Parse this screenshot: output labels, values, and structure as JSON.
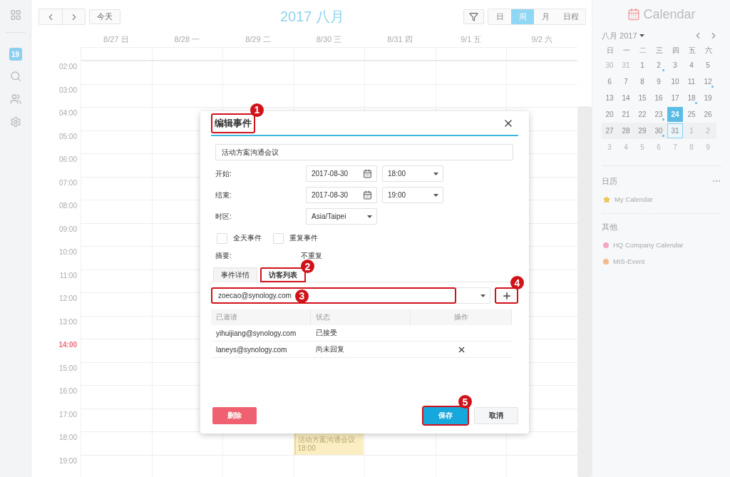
{
  "rail": {
    "items": [
      {
        "kind": "apps",
        "selected": false
      },
      {
        "kind": "calendar",
        "badge": "19",
        "selected": true
      },
      {
        "kind": "search",
        "selected": false
      },
      {
        "kind": "people",
        "selected": false
      },
      {
        "kind": "settings",
        "selected": false
      }
    ]
  },
  "toolbar": {
    "today": "今天",
    "title": "2017 八月",
    "views": [
      {
        "label": "日",
        "selected": false
      },
      {
        "label": "周",
        "selected": true
      },
      {
        "label": "月",
        "selected": false
      },
      {
        "label": "日程",
        "selected": false
      }
    ]
  },
  "week": {
    "days": [
      {
        "label": "8/27 日"
      },
      {
        "label": "8/28 一"
      },
      {
        "label": "8/29 二"
      },
      {
        "label": "8/30 三",
        "events": [
          {
            "title": "活动方案沟通会议",
            "time": "18:00",
            "color": "#fbeec3"
          }
        ]
      },
      {
        "label": "8/31 四"
      },
      {
        "label": "9/1 五"
      },
      {
        "label": "9/2 六"
      }
    ],
    "hours": [
      {
        "label": "02:00",
        "now": false
      },
      {
        "label": "03:00",
        "now": false
      },
      {
        "label": "04:00",
        "now": false
      },
      {
        "label": "05:00",
        "now": false
      },
      {
        "label": "06:00",
        "now": false
      },
      {
        "label": "07:00",
        "now": false
      },
      {
        "label": "08:00",
        "now": false
      },
      {
        "label": "09:00",
        "now": false
      },
      {
        "label": "10:00",
        "now": false
      },
      {
        "label": "11:00",
        "now": false
      },
      {
        "label": "12:00",
        "now": false
      },
      {
        "label": "13:00",
        "now": false
      },
      {
        "label": "14:00",
        "now": true
      },
      {
        "label": "15:00",
        "now": false
      },
      {
        "label": "16:00",
        "now": false
      },
      {
        "label": "17:00",
        "now": false
      },
      {
        "label": "18:00",
        "now": false
      },
      {
        "label": "19:00",
        "now": false
      }
    ]
  },
  "sidebar": {
    "app_title": "Calendar",
    "mini_calendar": {
      "month": "八月 2017",
      "weekdays": [
        "日",
        "一",
        "二",
        "三",
        "四",
        "五",
        "六"
      ],
      "weeks": [
        {
          "current": false,
          "days": [
            {
              "d": "30",
              "muted": true,
              "dot": false,
              "selected": false,
              "today": false
            },
            {
              "d": "31",
              "muted": true,
              "dot": false,
              "selected": false,
              "today": false
            },
            {
              "d": "1",
              "muted": false,
              "dot": false,
              "selected": false,
              "today": false
            },
            {
              "d": "2",
              "muted": false,
              "dot": true,
              "selected": false,
              "today": false
            },
            {
              "d": "3",
              "muted": false,
              "dot": false,
              "selected": false,
              "today": false
            },
            {
              "d": "4",
              "muted": false,
              "dot": false,
              "selected": false,
              "today": false
            },
            {
              "d": "5",
              "muted": false,
              "dot": false,
              "selected": false,
              "today": false
            }
          ]
        },
        {
          "current": false,
          "days": [
            {
              "d": "6",
              "muted": false,
              "dot": false,
              "selected": false,
              "today": false
            },
            {
              "d": "7",
              "muted": false,
              "dot": false,
              "selected": false,
              "today": false
            },
            {
              "d": "8",
              "muted": false,
              "dot": false,
              "selected": false,
              "today": false
            },
            {
              "d": "9",
              "muted": false,
              "dot": false,
              "selected": false,
              "today": false
            },
            {
              "d": "10",
              "muted": false,
              "dot": false,
              "selected": false,
              "today": false
            },
            {
              "d": "11",
              "muted": false,
              "dot": false,
              "selected": false,
              "today": false
            },
            {
              "d": "12",
              "muted": false,
              "dot": true,
              "selected": false,
              "today": false
            }
          ]
        },
        {
          "current": false,
          "days": [
            {
              "d": "13",
              "muted": false,
              "dot": false,
              "selected": false,
              "today": false
            },
            {
              "d": "14",
              "muted": false,
              "dot": false,
              "selected": false,
              "today": false
            },
            {
              "d": "15",
              "muted": false,
              "dot": false,
              "selected": false,
              "today": false
            },
            {
              "d": "16",
              "muted": false,
              "dot": false,
              "selected": false,
              "today": false
            },
            {
              "d": "17",
              "muted": false,
              "dot": false,
              "selected": false,
              "today": false
            },
            {
              "d": "18",
              "muted": false,
              "dot": true,
              "selected": false,
              "today": false
            },
            {
              "d": "19",
              "muted": false,
              "dot": false,
              "selected": false,
              "today": false
            }
          ]
        },
        {
          "current": false,
          "days": [
            {
              "d": "20",
              "muted": false,
              "dot": false,
              "selected": false,
              "today": false
            },
            {
              "d": "21",
              "muted": false,
              "dot": false,
              "selected": false,
              "today": false
            },
            {
              "d": "22",
              "muted": false,
              "dot": false,
              "selected": false,
              "today": false
            },
            {
              "d": "23",
              "muted": false,
              "dot": true,
              "selected": false,
              "today": false
            },
            {
              "d": "24",
              "muted": false,
              "dot": false,
              "selected": true,
              "today": false
            },
            {
              "d": "25",
              "muted": false,
              "dot": false,
              "selected": false,
              "today": false
            },
            {
              "d": "26",
              "muted": false,
              "dot": false,
              "selected": false,
              "today": false
            }
          ]
        },
        {
          "current": true,
          "days": [
            {
              "d": "27",
              "muted": false,
              "dot": false,
              "selected": false,
              "today": false
            },
            {
              "d": "28",
              "muted": false,
              "dot": false,
              "selected": false,
              "today": false
            },
            {
              "d": "29",
              "muted": false,
              "dot": false,
              "selected": false,
              "today": false
            },
            {
              "d": "30",
              "muted": false,
              "dot": true,
              "selected": false,
              "today": false
            },
            {
              "d": "31",
              "muted": false,
              "dot": false,
              "selected": false,
              "today": true
            },
            {
              "d": "1",
              "muted": true,
              "dot": false,
              "selected": false,
              "today": false
            },
            {
              "d": "2",
              "muted": true,
              "dot": false,
              "selected": false,
              "today": false
            }
          ]
        },
        {
          "current": false,
          "days": [
            {
              "d": "3",
              "muted": true,
              "dot": false,
              "selected": false,
              "today": false
            },
            {
              "d": "4",
              "muted": true,
              "dot": false,
              "selected": false,
              "today": false
            },
            {
              "d": "5",
              "muted": true,
              "dot": false,
              "selected": false,
              "today": false
            },
            {
              "d": "6",
              "muted": true,
              "dot": false,
              "selected": false,
              "today": false
            },
            {
              "d": "7",
              "muted": true,
              "dot": false,
              "selected": false,
              "today": false
            },
            {
              "d": "8",
              "muted": true,
              "dot": false,
              "selected": false,
              "today": false
            },
            {
              "d": "9",
              "muted": true,
              "dot": false,
              "selected": false,
              "today": false
            }
          ]
        }
      ]
    },
    "calendar_groups": [
      {
        "heading": "日历",
        "more": true,
        "items": [
          {
            "name": "My Calendar",
            "kind": "star"
          }
        ]
      },
      {
        "heading": "其他",
        "items": [
          {
            "name": "HQ Company Calendar",
            "kind": "dot",
            "color": "#f4a6c0"
          },
          {
            "name": "MIS-Event",
            "kind": "dot",
            "color": "#f6b98c"
          }
        ]
      }
    ]
  },
  "dialog": {
    "title": "编辑事件",
    "callout": "1",
    "event_title": "活动方案沟通会议",
    "fields": [
      {
        "label": "开始:",
        "kind": "datetime",
        "date": "2017-08-30",
        "time": "18:00"
      },
      {
        "label": "结束:",
        "kind": "datetime",
        "date": "2017-08-30",
        "time": "19:00"
      },
      {
        "label": "时区:",
        "kind": "select",
        "value": "Asia/Taipei"
      }
    ],
    "options": [
      {
        "label": "全天事件",
        "checked": false
      },
      {
        "label": "重复事件",
        "checked": false
      }
    ],
    "summary": {
      "label": "摘要:",
      "value": "不重复"
    },
    "tabs": [
      {
        "label": "事件详情",
        "selected": false
      },
      {
        "label": "访客列表",
        "selected": true,
        "callout": "2"
      }
    ],
    "guest_input": {
      "value": "zoecao@synology.com",
      "callout": "3"
    },
    "add_button": {
      "callout": "4"
    },
    "guests": {
      "columns": [
        "已邀请",
        "状态",
        "操作"
      ],
      "rows": [
        {
          "email": "yihuijiang@synology.com",
          "status": "已接受"
        },
        {
          "email": "laneys@synology.com",
          "status": "尚未回复",
          "removable": true
        }
      ]
    },
    "buttons": [
      {
        "label": "删除",
        "kind": "danger"
      },
      {
        "label": "保存",
        "kind": "primary",
        "callout": "5"
      },
      {
        "label": "取消",
        "kind": "default"
      }
    ]
  }
}
